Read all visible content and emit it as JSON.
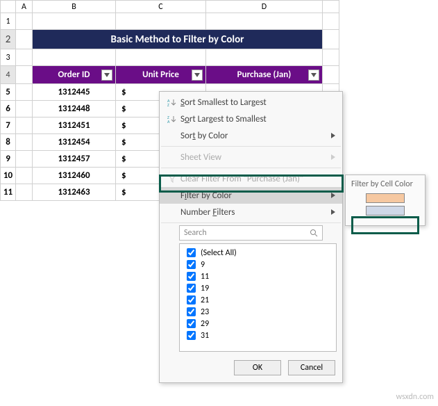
{
  "columns": {
    "A": "A",
    "B": "B",
    "C": "C",
    "D": "D"
  },
  "rows": [
    "1",
    "2",
    "3",
    "4",
    "5",
    "6",
    "7",
    "8",
    "9",
    "10",
    "11"
  ],
  "title": "Basic Method to Filter by Color",
  "table": {
    "headers": {
      "order": "Order ID",
      "price": "Unit Price",
      "purchase": "Purchase (Jan)"
    },
    "rows": [
      {
        "order": "1312445",
        "price": "$"
      },
      {
        "order": "1312448",
        "price": "$"
      },
      {
        "order": "1312451",
        "price": "$"
      },
      {
        "order": "1312454",
        "price": "$"
      },
      {
        "order": "1312457",
        "price": "$"
      },
      {
        "order": "1312460",
        "price": "$"
      },
      {
        "order": "1312463",
        "price": "$"
      }
    ]
  },
  "menu": {
    "sort_asc": "Sort Smallest to Largest",
    "sort_desc": "Sort Largest to Smallest",
    "sort_color": "Sort by Color",
    "sheet_view": "Sheet View",
    "clear": "Clear Filter From \"Purchase (Jan)\"",
    "filter_color": "Filter by Color",
    "number_filters": "Number Filters",
    "search_placeholder": "Search",
    "select_all": "(Select All)",
    "values": [
      "9",
      "11",
      "19",
      "21",
      "23",
      "29",
      "31"
    ],
    "ok": "OK",
    "cancel": "Cancel"
  },
  "submenu": {
    "title": "Filter by Cell Color",
    "colors": [
      "#f6c8a1",
      "#cfd8e8"
    ]
  },
  "watermark": "wsxdn.com"
}
